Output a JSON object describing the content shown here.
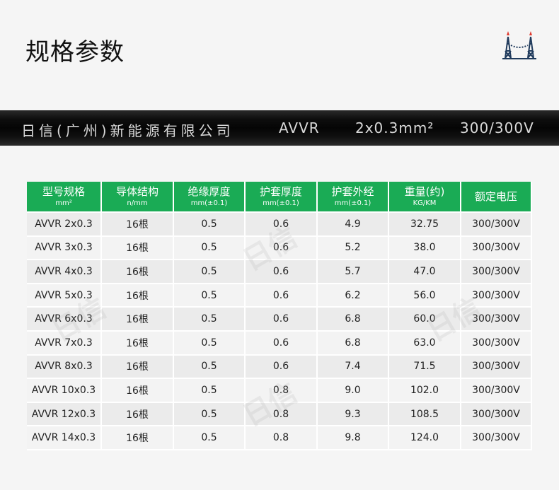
{
  "page": {
    "title": "规格参数"
  },
  "cable": {
    "company": "日信(广州)新能源有限公司",
    "model": "AVVR",
    "spec": "2x0.3mm²",
    "voltage": "300/300V"
  },
  "table": {
    "headers": [
      {
        "label": "型号规格",
        "unit": "mm²"
      },
      {
        "label": "导体结构",
        "unit": "n/mm"
      },
      {
        "label": "绝缘厚度",
        "unit": "mm(±0.1)"
      },
      {
        "label": "护套厚度",
        "unit": "mm(±0.1)"
      },
      {
        "label": "护套外经",
        "unit": "mm(±0.1)"
      },
      {
        "label": "重量(约)",
        "unit": "KG/KM"
      },
      {
        "label": "额定电压",
        "unit": ""
      }
    ],
    "rows": [
      [
        "AVVR 2x0.3",
        "16根",
        "0.5",
        "0.6",
        "4.9",
        "32.75",
        "300/300V"
      ],
      [
        "AVVR 3x0.3",
        "16根",
        "0.5",
        "0.6",
        "5.2",
        "38.0",
        "300/300V"
      ],
      [
        "AVVR 4x0.3",
        "16根",
        "0.5",
        "0.6",
        "5.7",
        "47.0",
        "300/300V"
      ],
      [
        "AVVR 5x0.3",
        "16根",
        "0.5",
        "0.6",
        "6.2",
        "56.0",
        "300/300V"
      ],
      [
        "AVVR 6x0.3",
        "16根",
        "0.5",
        "0.6",
        "6.8",
        "60.0",
        "300/300V"
      ],
      [
        "AVVR 7x0.3",
        "16根",
        "0.5",
        "0.6",
        "6.8",
        "63.0",
        "300/300V"
      ],
      [
        "AVVR 8x0.3",
        "16根",
        "0.5",
        "0.6",
        "7.4",
        "71.5",
        "300/300V"
      ],
      [
        "AVVR 10x0.3",
        "16根",
        "0.5",
        "0.8",
        "9.0",
        "102.0",
        "300/300V"
      ],
      [
        "AVVR 12x0.3",
        "16根",
        "0.5",
        "0.8",
        "9.3",
        "108.5",
        "300/300V"
      ],
      [
        "AVVR 14x0.3",
        "16根",
        "0.5",
        "0.8",
        "9.8",
        "124.0",
        "300/300V"
      ]
    ]
  },
  "watermark": "日信",
  "icons": {
    "header_icon": "transmission-tower-icon"
  },
  "colors": {
    "header_green": "#1aab55",
    "cable_black": "#0a0a0a"
  }
}
